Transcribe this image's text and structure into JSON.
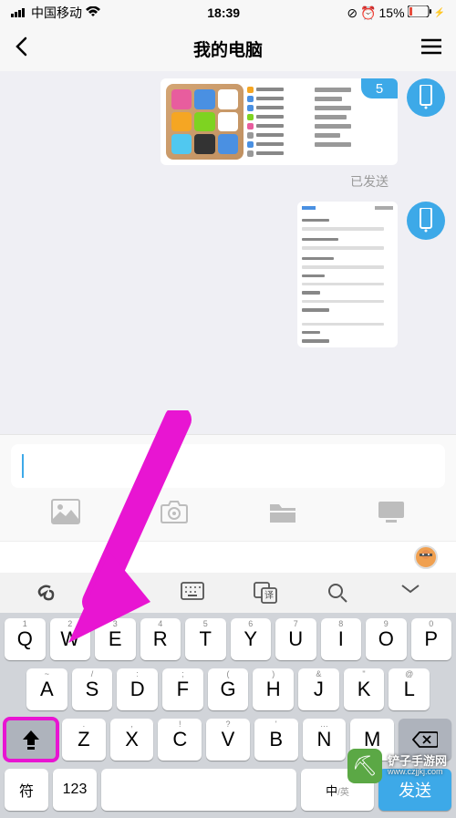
{
  "status": {
    "carrier": "中国移动",
    "time": "18:39",
    "battery": "15%"
  },
  "header": {
    "title": "我的电脑"
  },
  "chat": {
    "badge": "5",
    "sent_label": "已发送"
  },
  "keyboard": {
    "row1": [
      {
        "num": "1",
        "letter": "Q"
      },
      {
        "num": "2",
        "letter": "W"
      },
      {
        "num": "3",
        "letter": "E"
      },
      {
        "num": "4",
        "letter": "R"
      },
      {
        "num": "5",
        "letter": "T"
      },
      {
        "num": "6",
        "letter": "Y"
      },
      {
        "num": "7",
        "letter": "U"
      },
      {
        "num": "8",
        "letter": "I"
      },
      {
        "num": "9",
        "letter": "O"
      },
      {
        "num": "0",
        "letter": "P"
      }
    ],
    "row2": [
      {
        "sym": "~",
        "letter": "A"
      },
      {
        "sym": "/",
        "letter": "S"
      },
      {
        "sym": ":",
        "letter": "D"
      },
      {
        "sym": ";",
        "letter": "F"
      },
      {
        "sym": "(",
        "letter": "G"
      },
      {
        "sym": ")",
        "letter": "H"
      },
      {
        "sym": "&",
        "letter": "J"
      },
      {
        "sym": "\"",
        "letter": "K"
      },
      {
        "sym": "@",
        "letter": "L"
      }
    ],
    "row3": [
      {
        "sym": ".",
        "letter": "Z"
      },
      {
        "sym": ",",
        "letter": "X"
      },
      {
        "sym": "!",
        "letter": "C"
      },
      {
        "sym": "?",
        "letter": "V"
      },
      {
        "sym": "'",
        "letter": "B"
      },
      {
        "sym": "…",
        "letter": "N"
      },
      {
        "sym": "",
        "letter": "M"
      }
    ],
    "symbol_key": "符",
    "num_key": "123",
    "lang_key": "中/英",
    "send_key": "发送"
  },
  "watermark": {
    "line1": "铲子手游网",
    "line2": "www.czjjkj.com"
  },
  "colors": {
    "accent": "#3DA9E8",
    "highlight": "#E815D2"
  }
}
